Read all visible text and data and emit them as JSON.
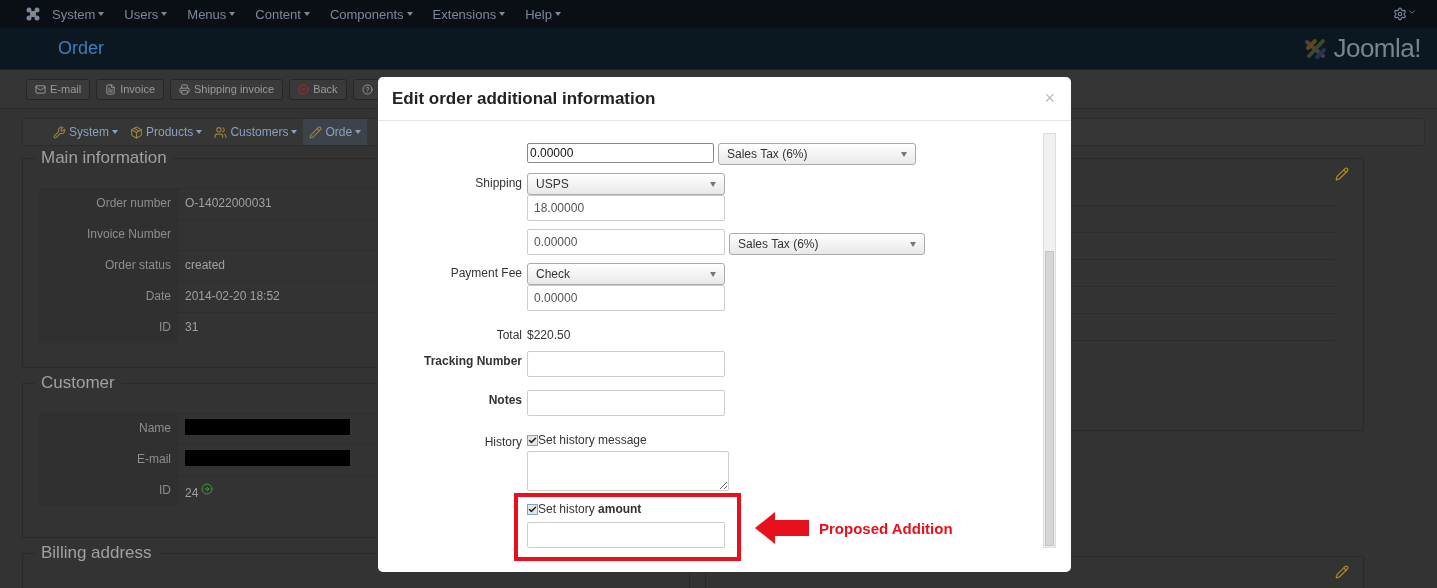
{
  "top_menu": {
    "items": [
      "System",
      "Users",
      "Menus",
      "Content",
      "Components",
      "Extensions",
      "Help"
    ]
  },
  "header": {
    "title": "Order",
    "logo_text": "Joomla!"
  },
  "toolbar": {
    "buttons": [
      {
        "kind": "mail",
        "label": "E-mail"
      },
      {
        "kind": "invoice",
        "label": "Invoice"
      },
      {
        "kind": "shipping",
        "label": "Shipping invoice"
      },
      {
        "kind": "back",
        "label": "Back"
      },
      {
        "kind": "help"
      }
    ]
  },
  "submenu": {
    "items": [
      {
        "kind": "system",
        "label": "System",
        "selected": false
      },
      {
        "kind": "products",
        "label": "Products",
        "selected": false
      },
      {
        "kind": "customers",
        "label": "Customers",
        "selected": false
      },
      {
        "kind": "orders",
        "label": "Orde",
        "selected": true
      }
    ]
  },
  "main_information": {
    "legend": "Main information",
    "rows": [
      {
        "label": "Order number",
        "value": "O-14022000031"
      },
      {
        "label": "Invoice Number"
      },
      {
        "label": "Order status",
        "value": "created"
      },
      {
        "label": "Date",
        "value": "2014-02-20 18:52"
      },
      {
        "label": "ID",
        "value": "31"
      }
    ]
  },
  "customer": {
    "legend": "Customer",
    "rows": [
      {
        "kind": "redacted",
        "label": "Name"
      },
      {
        "kind": "redacted",
        "label": "E-mail"
      },
      {
        "kind": "link",
        "label": "ID",
        "value": "24"
      }
    ]
  },
  "billing_address": {
    "legend": "Billing address"
  },
  "modal": {
    "title": "Edit order additional information",
    "close": "×",
    "fields": [
      {
        "kind": "input_select",
        "value": "0.00000",
        "select": "Sales Tax (6%)"
      },
      {
        "kind": "select_input",
        "label": "Shipping",
        "select": "USPS",
        "value": "18.00000"
      },
      {
        "kind": "input_select",
        "value": "0.00000",
        "select": "Sales Tax (6%)"
      },
      {
        "kind": "select_input",
        "label": "Payment Fee",
        "select": "Check",
        "value": "0.00000"
      },
      {
        "kind": "text",
        "label": "Total",
        "value": "$220.50"
      },
      {
        "kind": "input",
        "label": "Tracking Number"
      },
      {
        "kind": "input",
        "label": "Notes"
      },
      {
        "kind": "history",
        "label": "History",
        "checkbox": "Set history message",
        "checked": true
      }
    ],
    "proposed": {
      "checkbox": "Set history **amount**",
      "checked": true
    }
  },
  "callout": "Proposed Addition"
}
